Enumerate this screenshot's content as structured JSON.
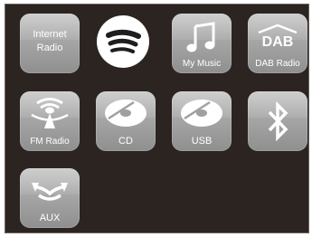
{
  "tiles": {
    "internet_radio": {
      "line1": "Internet",
      "line2": "Radio",
      "icon": "internet-radio"
    },
    "spotify": {
      "icon": "spotify-icon"
    },
    "my_music": {
      "label": "My Music",
      "icon": "music-note-icon"
    },
    "dab_radio": {
      "label": "DAB Radio",
      "icon": "dab-logo-icon",
      "logo_text": "DAB"
    },
    "fm_radio": {
      "label": "FM Radio",
      "icon": "antenna-icon"
    },
    "cd": {
      "label": "CD",
      "icon": "disc-icon"
    },
    "usb": {
      "label": "USB",
      "icon": "disc-icon"
    },
    "bluetooth": {
      "icon": "bluetooth-icon"
    },
    "aux": {
      "label": "AUX",
      "icon": "aux-arrows-icon"
    }
  },
  "colors": {
    "background": "#2b2420",
    "tile": "#a8a8a8",
    "label": "#ffffff",
    "spotify_circle": "#ffffff",
    "spotify_bars": "#1e1e1e"
  }
}
